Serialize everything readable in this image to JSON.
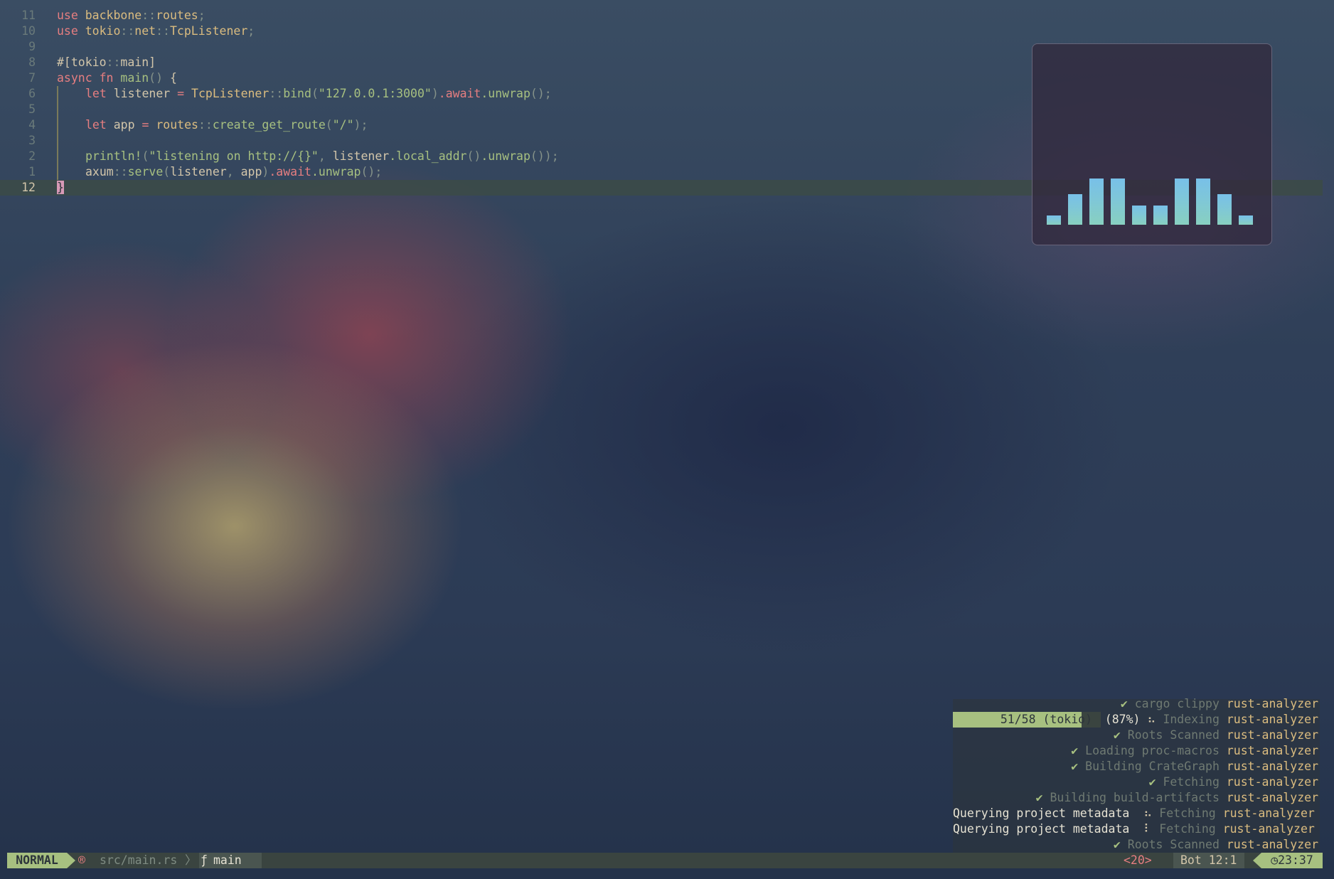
{
  "editor": {
    "lines": [
      {
        "num": "11",
        "k1": "use",
        "t1": " backbone",
        "p1": "::",
        "t2": "routes",
        "p2": ";"
      },
      {
        "num": "10",
        "k1": "use",
        "t1": " tokio",
        "p1": "::",
        "t2": "net",
        "p2": "::",
        "t3": "TcpListener",
        "p3": ";"
      },
      {
        "num": "9"
      },
      {
        "num": "8",
        "a1": "#[tokio",
        "p1": "::",
        "a2": "main]"
      },
      {
        "num": "7",
        "k1": "async",
        "k2": " fn",
        "f1": " main",
        "p1": "()",
        "t1": " {"
      },
      {
        "num": "6",
        "k1": "let",
        "t1": " listener ",
        "p1": "=",
        "ty1": " TcpListener",
        "p2": "::",
        "f1": "bind",
        "p3": "(",
        "s1": "\"127.0.0.1:3000\"",
        "p4": ")",
        "k2": ".await",
        "f2": ".unwrap",
        "p5": "();"
      },
      {
        "num": "5"
      },
      {
        "num": "4",
        "k1": "let",
        "t1": " app ",
        "p1": "=",
        "t2": " routes",
        "p2": "::",
        "f1": "create_get_route",
        "p3": "(",
        "s1": "\"/\"",
        "p4": ");"
      },
      {
        "num": "3"
      },
      {
        "num": "2",
        "f1": "println!",
        "p1": "(",
        "s1": "\"listening on http://{}\"",
        "p2": ",",
        "t1": " listener",
        "f2": ".local_addr",
        "p3": "()",
        "f3": ".unwrap",
        "p4": "());"
      },
      {
        "num": "1",
        "t1": "axum",
        "p1": "::",
        "f1": "serve",
        "p2": "(",
        "t2": "listener",
        "p3": ", ",
        "t3": "app",
        "p4": ")",
        "k1": ".await",
        "f2": ".unwrap",
        "p5": "();"
      },
      {
        "num": "12",
        "c1": "}"
      }
    ]
  },
  "visualizer": {
    "levels": [
      0.18,
      0.6,
      0.9,
      0.9,
      0.38,
      0.38,
      0.9,
      0.9,
      0.6,
      0.18
    ]
  },
  "notifications": [
    {
      "check": "✔",
      "message": "cargo clippy",
      "source": "rust-analyzer"
    },
    {
      "progress_label": "51/58 (tokio)",
      "progress_value": 0.87,
      "percent": "(87%)",
      "spinner": "⠦",
      "message": "Indexing",
      "source": "rust-analyzer"
    },
    {
      "check": "✔",
      "message": "Roots Scanned",
      "source": "rust-analyzer"
    },
    {
      "check": "✔",
      "message": "Loading proc-macros",
      "source": "rust-analyzer"
    },
    {
      "check": "✔",
      "message": "Building CrateGraph",
      "source": "rust-analyzer"
    },
    {
      "check": "✔",
      "message": "Fetching",
      "source": "rust-analyzer"
    },
    {
      "check": "✔",
      "message": "Building build-artifacts",
      "source": "rust-analyzer"
    },
    {
      "title": "Querying project metadata",
      "spinner": "⠦",
      "message": "Fetching",
      "source": "rust-analyzer"
    },
    {
      "title": "Querying project metadata",
      "spinner": "⠇",
      "message": "Fetching",
      "source": "rust-analyzer"
    },
    {
      "check": "✔",
      "message": "Roots Scanned",
      "source": "rust-analyzer"
    }
  ],
  "statusline": {
    "mode": "NORMAL",
    "file": "src/main.rs",
    "separator": "〉",
    "fn_icon": "ƒ",
    "breadcrumb": "main",
    "diagnostics": "<20>",
    "scroll": "Bot",
    "position": "12:1",
    "clock_icon": "◷",
    "time": "23:37"
  }
}
